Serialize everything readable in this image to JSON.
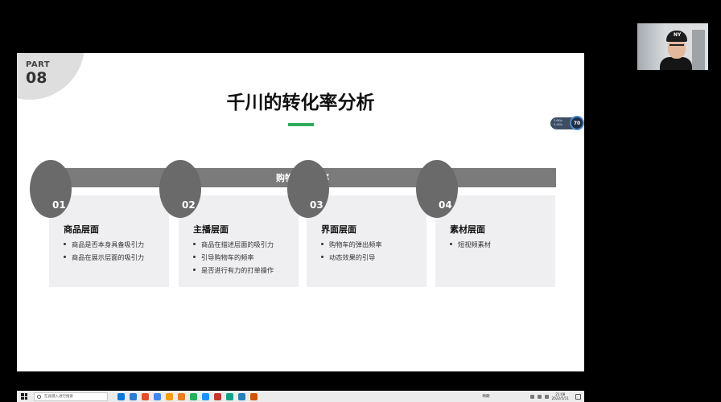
{
  "slide": {
    "part_label": "PART",
    "part_number": "08",
    "title": "千川的转化率分析",
    "banner": "购物车点击率",
    "cards": [
      {
        "num": "01",
        "title": "商品层面",
        "items": [
          "商品是否本身具备吸引力",
          "商品在展示层面的吸引力"
        ]
      },
      {
        "num": "02",
        "title": "主播层面",
        "items": [
          "商品在描述层面的吸引力",
          "引导购物车的频率",
          "是否进行有力的打单操作"
        ]
      },
      {
        "num": "03",
        "title": "界面层面",
        "items": [
          "购物车的弹出频率",
          "动态效果的引导"
        ]
      },
      {
        "num": "04",
        "title": "素材层面",
        "items": [
          "短视频素材"
        ]
      }
    ]
  },
  "meter": {
    "value": "70",
    "line1": "3.6K/s",
    "line2": "0.4K/s"
  },
  "taskbar": {
    "search_placeholder": "在此键入进行搜索",
    "weather": "晴朗",
    "time": "21:08",
    "date": "2022/5/11",
    "app_colors": [
      "#0078d4",
      "#2b7cd3",
      "#e44d26",
      "#4285f4",
      "#f39c12",
      "#e67e22",
      "#27ae60",
      "#1e90ff",
      "#c0392b",
      "#16a085",
      "#2980b9",
      "#d35400"
    ]
  },
  "webcam": {
    "cap_logo": "NY"
  },
  "colors": {
    "accent_green": "#2eaa5c",
    "banner_gray": "#7b7b7b",
    "card_bg": "#efeff2"
  }
}
